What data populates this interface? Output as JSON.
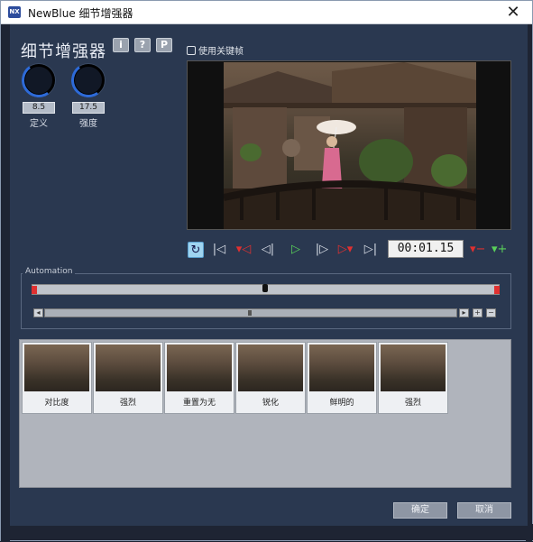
{
  "window": {
    "title": "NewBlue 细节增强器",
    "logo": "NX",
    "close_label": "✕"
  },
  "effect": {
    "name": "细节增强器",
    "buttons": [
      "i",
      "?",
      "P"
    ]
  },
  "knobs": [
    {
      "label": "定义",
      "value": "8.5"
    },
    {
      "label": "强度",
      "value": "17.5"
    }
  ],
  "keyframe": {
    "label": "使用关键帧"
  },
  "transport": {
    "timecode": "00:01.15"
  },
  "automation": {
    "label": "Automation"
  },
  "presets": [
    {
      "label": "对比度"
    },
    {
      "label": "强烈"
    },
    {
      "label": "重置为无"
    },
    {
      "label": "锐化"
    },
    {
      "label": "鲜明的"
    },
    {
      "label": "强烈"
    }
  ],
  "footer": {
    "ok_label": "确定",
    "cancel_label": "取消"
  },
  "colors": {
    "panel": "#2a3850",
    "knob_accent": "#2d6ad8",
    "play_green": "#5ad05a",
    "marker_red": "#e03030"
  }
}
